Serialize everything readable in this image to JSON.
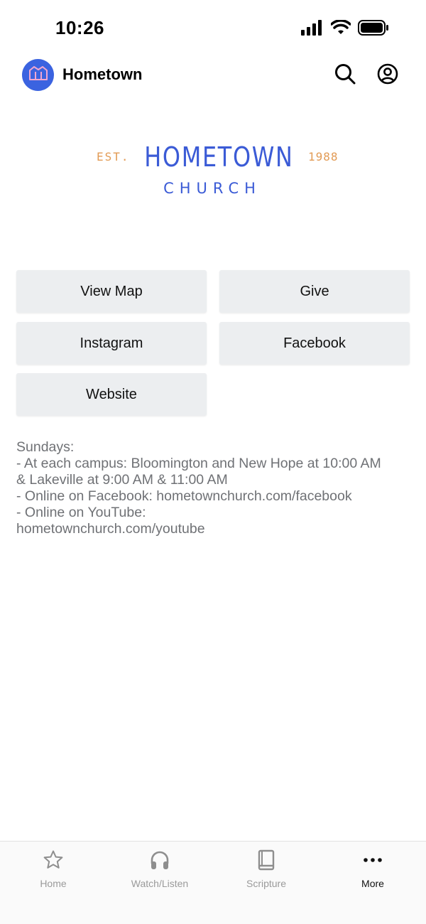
{
  "status_bar": {
    "time": "10:26",
    "icons": [
      "signal-icon",
      "wifi-icon",
      "battery-icon"
    ]
  },
  "header": {
    "title": "Hometown",
    "avatar_icon": "church-icon",
    "accent": "#3b63e0",
    "actions": [
      "search-icon",
      "account-icon"
    ]
  },
  "logo": {
    "est": "EST.",
    "name": "HOMETOWN",
    "sub": "CHURCH",
    "year": "1988",
    "primary_color": "#3b5bd6",
    "secondary_color": "#e29b55"
  },
  "links": {
    "view_map": "View Map",
    "give": "Give",
    "instagram": "Instagram",
    "facebook": "Facebook",
    "website": "Website"
  },
  "info": {
    "lines": [
      "Sundays:",
      "- At each campus:  Bloomington and New Hope at 10:00 AM",
      "& Lakeville at 9:00 AM & 11:00 AM",
      "- Online on Facebook: hometownchurch.com/facebook",
      "- Online on YouTube:",
      "hometownchurch.com/youtube"
    ]
  },
  "tabs": [
    {
      "label": "Home",
      "icon": "star-icon",
      "active": false
    },
    {
      "label": "Watch/Listen",
      "icon": "headphones-icon",
      "active": false
    },
    {
      "label": "Scripture",
      "icon": "book-icon",
      "active": false
    },
    {
      "label": "More",
      "icon": "more-icon",
      "active": true
    }
  ]
}
